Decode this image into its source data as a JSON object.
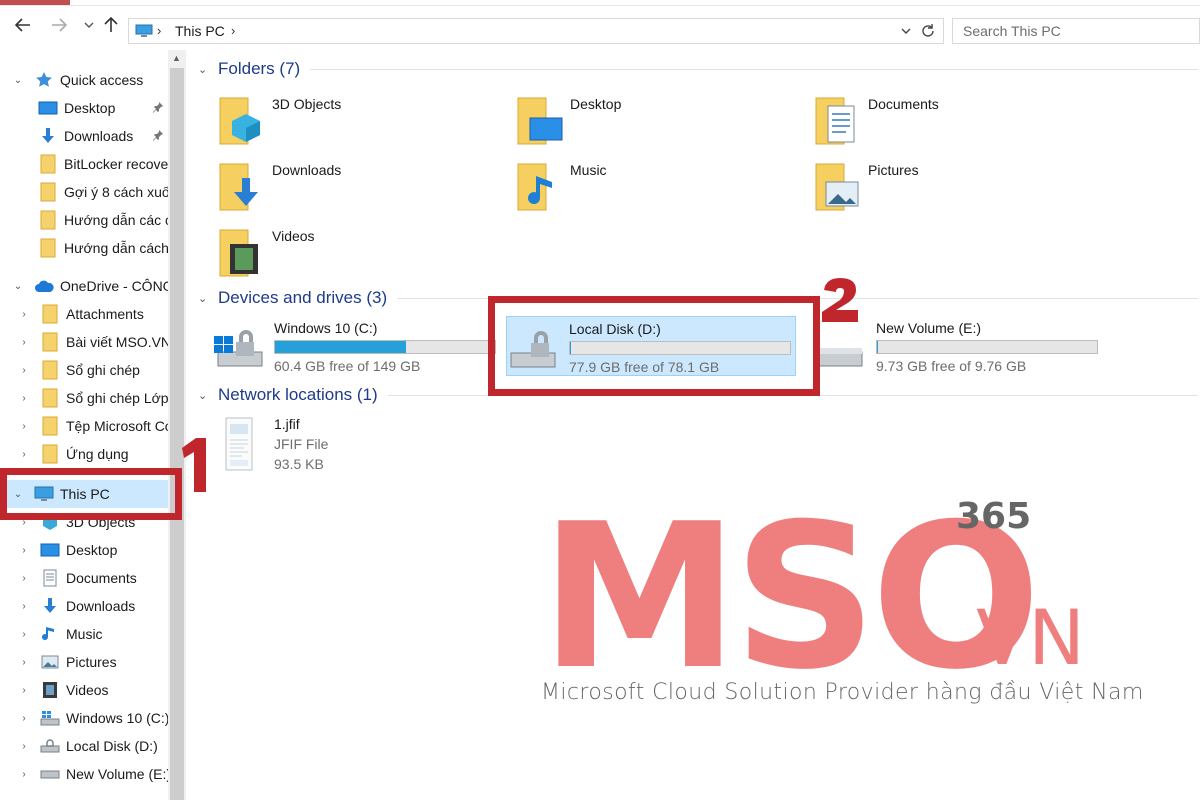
{
  "address": {
    "location": "This PC"
  },
  "search": {
    "placeholder": "Search This PC"
  },
  "sidebar": {
    "quick_access": {
      "label": "Quick access",
      "items": [
        "Desktop",
        "Downloads",
        "BitLocker recove",
        "Gợi ý 8 cách xuố",
        "Hướng dẫn các c",
        "Hướng dẫn cách"
      ]
    },
    "onedrive": {
      "label": "OneDrive - CÔNG",
      "items": [
        "Attachments",
        "Bài viết MSO.VN",
        "Sổ ghi chép",
        "Sổ ghi chép Lớp",
        "Tệp Microsoft Co",
        "Ứng dụng"
      ]
    },
    "this_pc": {
      "label": "This PC",
      "items": [
        "3D Objects",
        "Desktop",
        "Documents",
        "Downloads",
        "Music",
        "Pictures",
        "Videos",
        "Windows 10 (C:)",
        "Local Disk (D:)",
        "New Volume (E:)"
      ]
    }
  },
  "main": {
    "folders_header": "Folders (7)",
    "folders": [
      "3D Objects",
      "Desktop",
      "Documents",
      "Downloads",
      "Music",
      "Pictures",
      "Videos"
    ],
    "devices_header": "Devices and drives (3)",
    "drives": [
      {
        "name": "Windows 10 (C:)",
        "free": "60.4 GB free of 149 GB",
        "used_fraction": 0.595
      },
      {
        "name": "Local Disk (D:)",
        "free": "77.9 GB free of 78.1 GB",
        "used_fraction": 0.003
      },
      {
        "name": "New Volume (E:)",
        "free": "9.73 GB free of 9.76 GB",
        "used_fraction": 0.003
      }
    ],
    "network_header": "Network locations (1)",
    "network_file": {
      "name": "1.jfif",
      "type": "JFIF File",
      "size": "93.5 KB"
    }
  },
  "annotations": {
    "step1": "1",
    "step2": "2"
  },
  "watermark": {
    "brand": "MSO",
    "suffix": ".VN",
    "badge": "365",
    "tagline": "Microsoft Cloud Solution Provider hàng đầu Việt Nam"
  },
  "colors": {
    "selection": "#cce8ff",
    "drive_bar": "#26a0da",
    "highlight_box": "#c0272d",
    "watermark": "#ef7f7f",
    "group_title": "#1e3a8a"
  }
}
